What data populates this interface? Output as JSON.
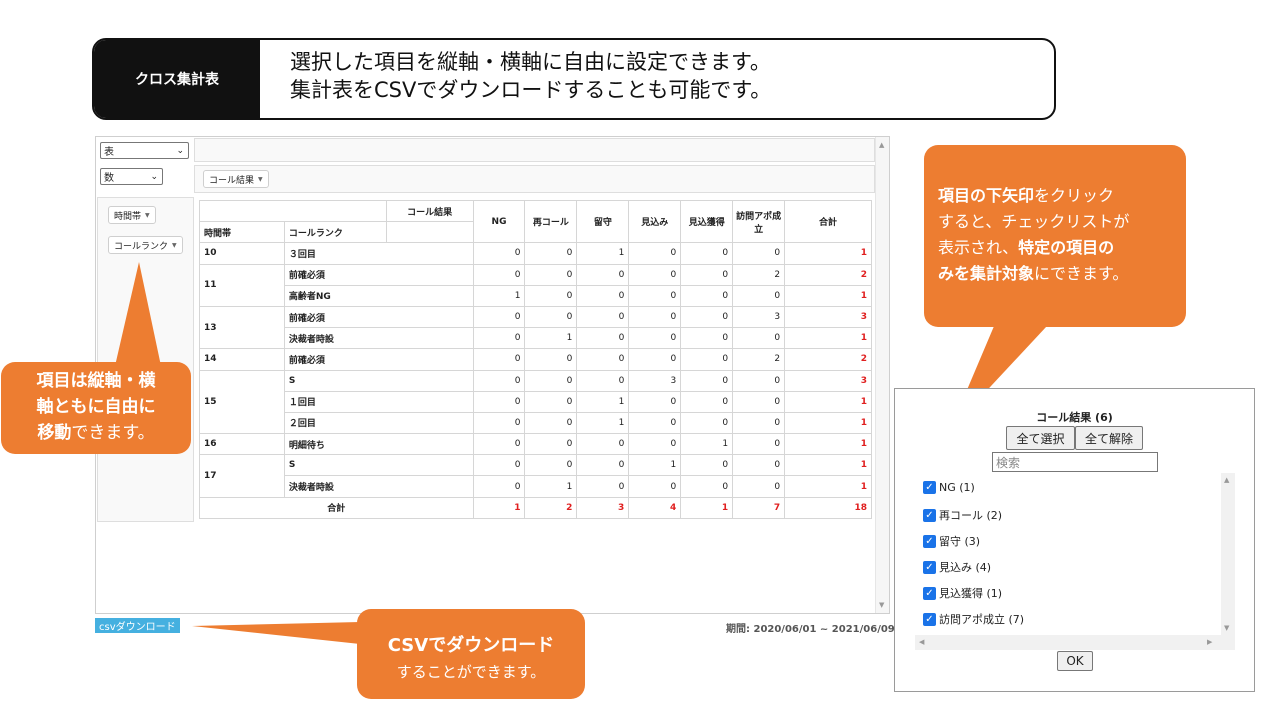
{
  "banner": {
    "label": "クロス集計表",
    "line1": "選択した項目を縦軸・横軸に自由に設定できます。",
    "line2": "集計表をCSVでダウンロードすることも可能です。"
  },
  "controls": {
    "renderer_value": "表",
    "aggregator_value": "数",
    "col_field": "コール結果",
    "row_field_1": "時間帯",
    "row_field_2": "コールランク"
  },
  "table": {
    "col_attr_label": "コール結果",
    "row_header_1": "時間帯",
    "row_header_2": "コールランク",
    "columns": [
      "NG",
      "再コール",
      "留守",
      "見込み",
      "見込獲得",
      "訪問アポ成立",
      "合計"
    ],
    "groups": [
      {
        "hour": "10",
        "rows": [
          {
            "rank": "３回目",
            "values": [
              "0",
              "0",
              "1",
              "0",
              "0",
              "0"
            ],
            "total": "1"
          }
        ]
      },
      {
        "hour": "11",
        "rows": [
          {
            "rank": "前確必須",
            "values": [
              "0",
              "0",
              "0",
              "0",
              "0",
              "2"
            ],
            "total": "2"
          },
          {
            "rank": "高齢者NG",
            "values": [
              "1",
              "0",
              "0",
              "0",
              "0",
              "0"
            ],
            "total": "1"
          }
        ]
      },
      {
        "hour": "13",
        "rows": [
          {
            "rank": "前確必須",
            "values": [
              "0",
              "0",
              "0",
              "0",
              "0",
              "3"
            ],
            "total": "3"
          },
          {
            "rank": "決裁者時設",
            "values": [
              "0",
              "1",
              "0",
              "0",
              "0",
              "0"
            ],
            "total": "1"
          }
        ]
      },
      {
        "hour": "14",
        "rows": [
          {
            "rank": "前確必須",
            "values": [
              "0",
              "0",
              "0",
              "0",
              "0",
              "2"
            ],
            "total": "2"
          }
        ]
      },
      {
        "hour": "15",
        "rows": [
          {
            "rank": "S",
            "values": [
              "0",
              "0",
              "0",
              "3",
              "0",
              "0"
            ],
            "total": "3"
          },
          {
            "rank": "１回目",
            "values": [
              "0",
              "0",
              "1",
              "0",
              "0",
              "0"
            ],
            "total": "1"
          },
          {
            "rank": "２回目",
            "values": [
              "0",
              "0",
              "1",
              "0",
              "0",
              "0"
            ],
            "total": "1"
          }
        ]
      },
      {
        "hour": "16",
        "rows": [
          {
            "rank": "明細待ち",
            "values": [
              "0",
              "0",
              "0",
              "0",
              "1",
              "0"
            ],
            "total": "1"
          }
        ]
      },
      {
        "hour": "17",
        "rows": [
          {
            "rank": "S",
            "values": [
              "0",
              "0",
              "0",
              "1",
              "0",
              "0"
            ],
            "total": "1"
          },
          {
            "rank": "決裁者時設",
            "values": [
              "0",
              "1",
              "0",
              "0",
              "0",
              "0"
            ],
            "total": "1"
          }
        ]
      }
    ],
    "total_label": "合計",
    "col_totals": [
      "1",
      "2",
      "3",
      "4",
      "1",
      "7",
      "18"
    ]
  },
  "footer": {
    "csv_button": "csvダウンロード",
    "period": "期間: 2020/06/01 ~ 2021/06/09"
  },
  "callouts": {
    "left": {
      "b1": "項目は縦軸・横",
      "b2": "軸ともに自由に",
      "b3": "移動",
      "t3": "できます。"
    },
    "right": {
      "b1": "項目の下矢印",
      "t1": "をクリック",
      "t2": "すると、チェックリストが",
      "t3a": "表示され、",
      "b3": "特定の項目の",
      "b4": "みを集計対象",
      "t4": "にできます。"
    },
    "bottom": {
      "b1": "CSVでダウンロード",
      "t2": "することができます。"
    }
  },
  "popup": {
    "title": "コール結果 (6)",
    "select_all": "全て選択",
    "deselect_all": "全て解除",
    "search_placeholder": "検索",
    "items": [
      "NG (1)",
      "再コール (2)",
      "留守 (3)",
      "見込み (4)",
      "見込獲得 (1)",
      "訪問アポ成立 (7)"
    ],
    "ok": "OK"
  },
  "colors": {
    "accent_orange": "#ed7d31",
    "total_red": "#e02020",
    "csv_blue": "#45b0e0",
    "checkbox_blue": "#1a73e8"
  }
}
